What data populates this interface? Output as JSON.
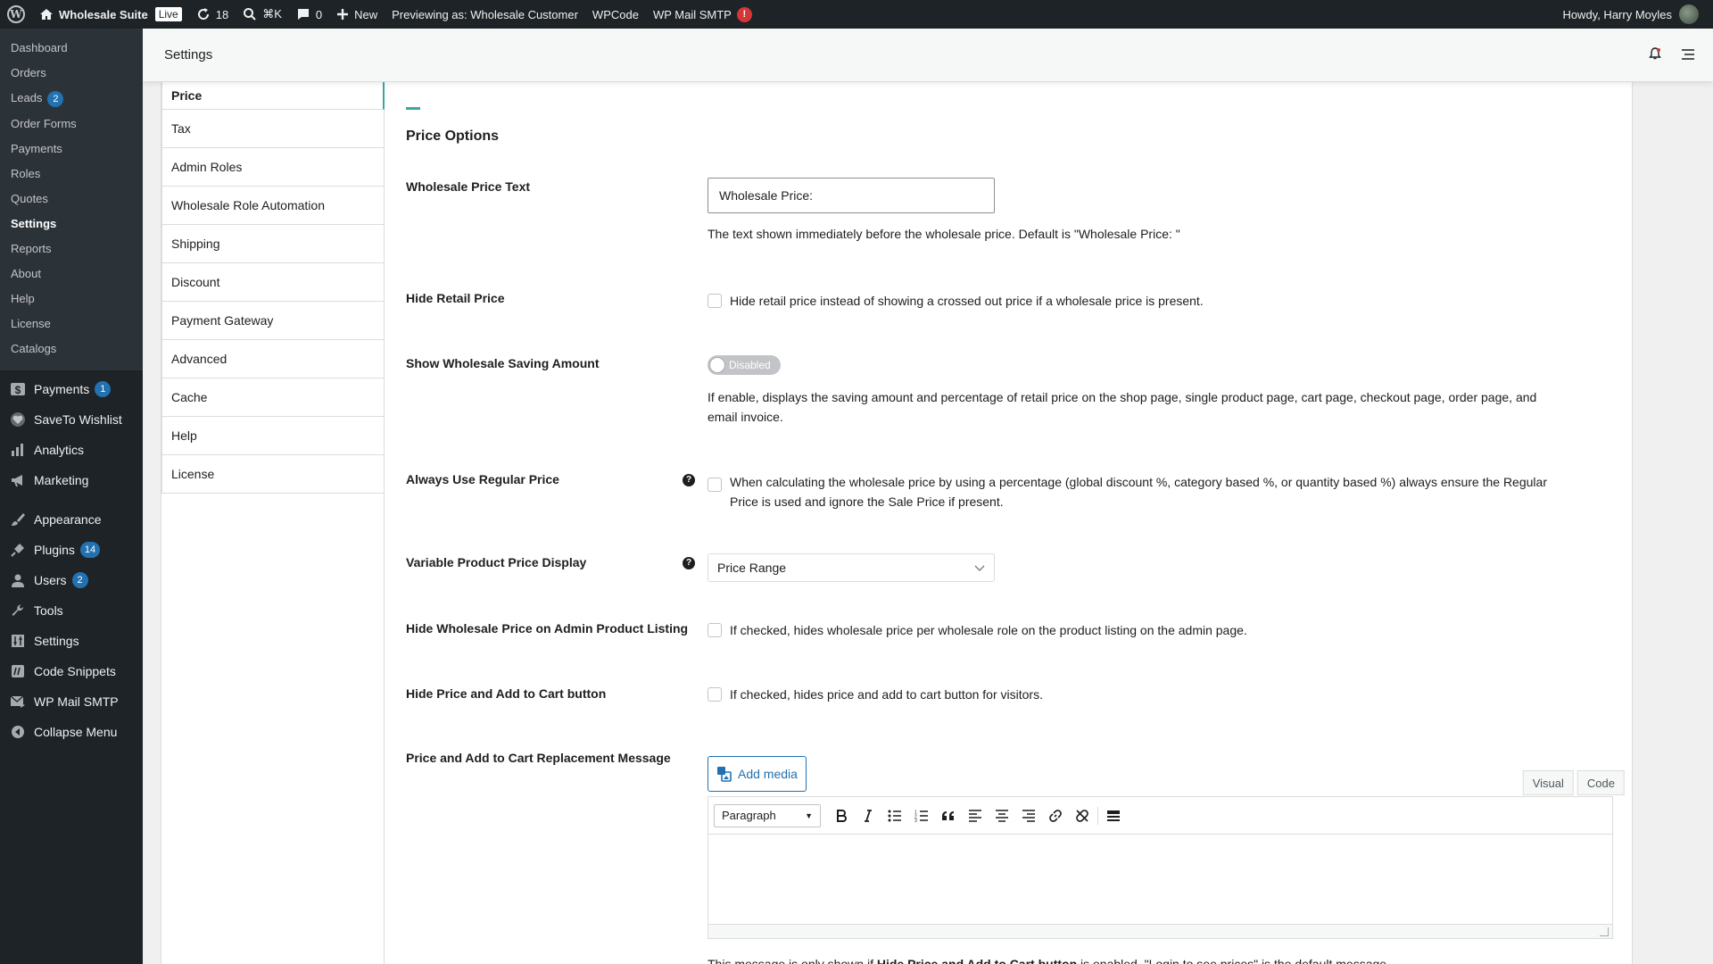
{
  "adminbar": {
    "site_name": "Wholesale Suite",
    "live_label": "Live",
    "updates_count": "18",
    "search_shortcut": "⌘K",
    "comments_count": "0",
    "new_label": "New",
    "previewing": "Previewing as: Wholesale Customer",
    "wpcode": "WPCode",
    "wpmail": "WP Mail SMTP",
    "wpmail_alert": "!",
    "howdy": "Howdy, Harry Moyles"
  },
  "sidebar": {
    "submenu": [
      {
        "label": "Dashboard",
        "badge": ""
      },
      {
        "label": "Orders",
        "badge": ""
      },
      {
        "label": "Leads",
        "badge": "2"
      },
      {
        "label": "Order Forms",
        "badge": ""
      },
      {
        "label": "Payments",
        "badge": ""
      },
      {
        "label": "Roles",
        "badge": ""
      },
      {
        "label": "Quotes",
        "badge": ""
      },
      {
        "label": "Settings",
        "badge": ""
      },
      {
        "label": "Reports",
        "badge": ""
      },
      {
        "label": "About",
        "badge": ""
      },
      {
        "label": "Help",
        "badge": ""
      },
      {
        "label": "License",
        "badge": ""
      },
      {
        "label": "Catalogs",
        "badge": ""
      }
    ],
    "menu": [
      {
        "label": "Payments",
        "badge": "1",
        "icon": "dollar-icon"
      },
      {
        "label": "SaveTo Wishlist",
        "badge": "",
        "icon": "wishlist-icon"
      },
      {
        "label": "Analytics",
        "badge": "",
        "icon": "analytics-icon"
      },
      {
        "label": "Marketing",
        "badge": "",
        "icon": "megaphone-icon"
      },
      {
        "label": "Appearance",
        "badge": "",
        "icon": "brush-icon"
      },
      {
        "label": "Plugins",
        "badge": "14",
        "icon": "plug-icon"
      },
      {
        "label": "Users",
        "badge": "2",
        "icon": "user-icon"
      },
      {
        "label": "Tools",
        "badge": "",
        "icon": "wrench-icon"
      },
      {
        "label": "Settings",
        "badge": "",
        "icon": "sliders-icon"
      },
      {
        "label": "Code Snippets",
        "badge": "",
        "icon": "code-icon"
      },
      {
        "label": "WP Mail SMTP",
        "badge": "",
        "icon": "mail-icon"
      },
      {
        "label": "Collapse Menu",
        "badge": "",
        "icon": "collapse-icon"
      }
    ]
  },
  "header": {
    "title": "Settings"
  },
  "tabs": [
    "Price",
    "Tax",
    "Admin Roles",
    "Wholesale Role Automation",
    "Shipping",
    "Discount",
    "Payment Gateway",
    "Advanced",
    "Cache",
    "Help",
    "License"
  ],
  "main": {
    "heading": "Price",
    "section_title": "Price Options",
    "wholesale_price_text": {
      "label": "Wholesale Price Text",
      "value": "Wholesale Price:",
      "desc": "The text shown immediately before the wholesale price. Default is \"Wholesale Price: \""
    },
    "hide_retail": {
      "label": "Hide Retail Price",
      "desc": "Hide retail price instead of showing a crossed out price if a wholesale price is present."
    },
    "saving_amount": {
      "label": "Show Wholesale Saving Amount",
      "toggle": "Disabled",
      "desc1": "If enable, displays the saving amount and percentage of retail price on the shop page, single product page, cart page, checkout page, order page, and",
      "desc2": "email invoice."
    },
    "regular_price": {
      "label": "Always Use Regular Price",
      "help": "?",
      "desc1": "When calculating the wholesale price by using a percentage (global discount %, category based %, or quantity based %) always ensure the Regular",
      "desc2": "Price is used and ignore the Sale Price if present."
    },
    "variable_display": {
      "label": "Variable Product Price Display",
      "help": "?",
      "value": "Price Range"
    },
    "hide_admin_listing": {
      "label": "Hide Wholesale Price on Admin Product Listing",
      "desc": "If checked, hides wholesale price per wholesale role on the product listing on the admin page."
    },
    "hide_price_cart": {
      "label": "Hide Price and Add to Cart button",
      "desc": "If checked, hides price and add to cart button for visitors."
    },
    "replacement": {
      "label": "Price and Add to Cart Replacement Message",
      "add_media": "Add media",
      "tab_visual": "Visual",
      "tab_code": "Code",
      "format": "Paragraph",
      "note_pre": "This message is only shown if ",
      "note_bold": "Hide Price and Add to Cart button",
      "note_post": " is enabled. \"Login to see prices\" is the default message."
    }
  },
  "colors": {
    "accent": "#3aa6a0",
    "adminbar_bg": "#1d2327",
    "badge": "#2271b1",
    "alert": "#d63638"
  }
}
